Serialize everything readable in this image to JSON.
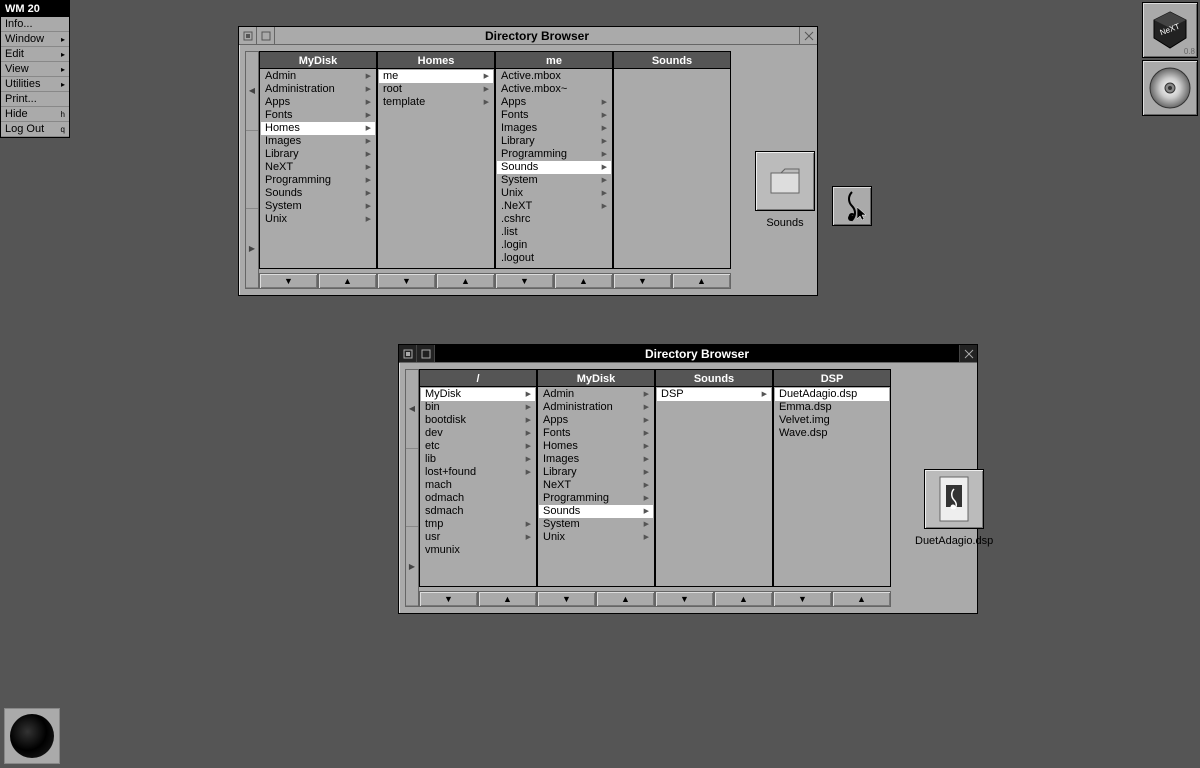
{
  "menu": {
    "title": "WM 20",
    "items": [
      {
        "label": "Info...",
        "accel": ""
      },
      {
        "label": "Window",
        "accel": "▸"
      },
      {
        "label": "Edit",
        "accel": "▸"
      },
      {
        "label": "View",
        "accel": "▸"
      },
      {
        "label": "Utilities",
        "accel": "▸"
      },
      {
        "label": "Print...",
        "accel": ""
      },
      {
        "label": "Hide",
        "accel": "h"
      },
      {
        "label": "Log Out",
        "accel": "q"
      }
    ]
  },
  "dock": {
    "next_version": "0.8"
  },
  "window1": {
    "title": "Directory Browser",
    "columns": [
      {
        "header": "MyDisk",
        "items": [
          {
            "t": "Admin",
            "s": true
          },
          {
            "t": "Administration",
            "s": true
          },
          {
            "t": "Apps",
            "s": true
          },
          {
            "t": "Fonts",
            "s": true
          },
          {
            "t": "Homes",
            "s": true,
            "sel": true
          },
          {
            "t": "Images",
            "s": true
          },
          {
            "t": "Library",
            "s": true
          },
          {
            "t": "NeXT",
            "s": true
          },
          {
            "t": "Programming",
            "s": true
          },
          {
            "t": "Sounds",
            "s": true
          },
          {
            "t": "System",
            "s": true
          },
          {
            "t": "Unix",
            "s": true
          }
        ]
      },
      {
        "header": "Homes",
        "items": [
          {
            "t": "me",
            "s": true,
            "sel": true
          },
          {
            "t": "root",
            "s": true
          },
          {
            "t": "template",
            "s": true
          }
        ]
      },
      {
        "header": "me",
        "items": [
          {
            "t": "Active.mbox",
            "s": false
          },
          {
            "t": "Active.mbox~",
            "s": false
          },
          {
            "t": "Apps",
            "s": true
          },
          {
            "t": "Fonts",
            "s": true
          },
          {
            "t": "Images",
            "s": true
          },
          {
            "t": "Library",
            "s": true
          },
          {
            "t": "Programming",
            "s": true
          },
          {
            "t": "Sounds",
            "s": true,
            "sel": true
          },
          {
            "t": "System",
            "s": true
          },
          {
            "t": "Unix",
            "s": true
          },
          {
            "t": ".NeXT",
            "s": true
          },
          {
            "t": ".cshrc",
            "s": false
          },
          {
            "t": ".list",
            "s": false
          },
          {
            "t": ".login",
            "s": false
          },
          {
            "t": ".logout",
            "s": false
          }
        ]
      },
      {
        "header": "Sounds",
        "items": []
      }
    ],
    "preview_label": "Sounds"
  },
  "window2": {
    "title": "Directory Browser",
    "columns": [
      {
        "header": "/",
        "items": [
          {
            "t": "MyDisk",
            "s": true,
            "sel": true
          },
          {
            "t": "bin",
            "s": true
          },
          {
            "t": "bootdisk",
            "s": true
          },
          {
            "t": "dev",
            "s": true
          },
          {
            "t": "etc",
            "s": true
          },
          {
            "t": "lib",
            "s": true
          },
          {
            "t": "lost+found",
            "s": true
          },
          {
            "t": "mach",
            "s": false
          },
          {
            "t": "odmach",
            "s": false
          },
          {
            "t": "sdmach",
            "s": false
          },
          {
            "t": "tmp",
            "s": true
          },
          {
            "t": "usr",
            "s": true
          },
          {
            "t": "vmunix",
            "s": false
          }
        ]
      },
      {
        "header": "MyDisk",
        "items": [
          {
            "t": "Admin",
            "s": true
          },
          {
            "t": "Administration",
            "s": true
          },
          {
            "t": "Apps",
            "s": true
          },
          {
            "t": "Fonts",
            "s": true
          },
          {
            "t": "Homes",
            "s": true
          },
          {
            "t": "Images",
            "s": true
          },
          {
            "t": "Library",
            "s": true
          },
          {
            "t": "NeXT",
            "s": true
          },
          {
            "t": "Programming",
            "s": true
          },
          {
            "t": "Sounds",
            "s": true,
            "sel": true
          },
          {
            "t": "System",
            "s": true
          },
          {
            "t": "Unix",
            "s": true
          }
        ]
      },
      {
        "header": "Sounds",
        "items": [
          {
            "t": "DSP",
            "s": true,
            "sel": true
          }
        ]
      },
      {
        "header": "DSP",
        "items": [
          {
            "t": "DuetAdagio.dsp",
            "s": false,
            "sel": true
          },
          {
            "t": "Emma.dsp",
            "s": false
          },
          {
            "t": "Velvet.img",
            "s": false
          },
          {
            "t": "Wave.dsp",
            "s": false
          }
        ]
      }
    ],
    "preview_label": "DuetAdagio.dsp"
  }
}
